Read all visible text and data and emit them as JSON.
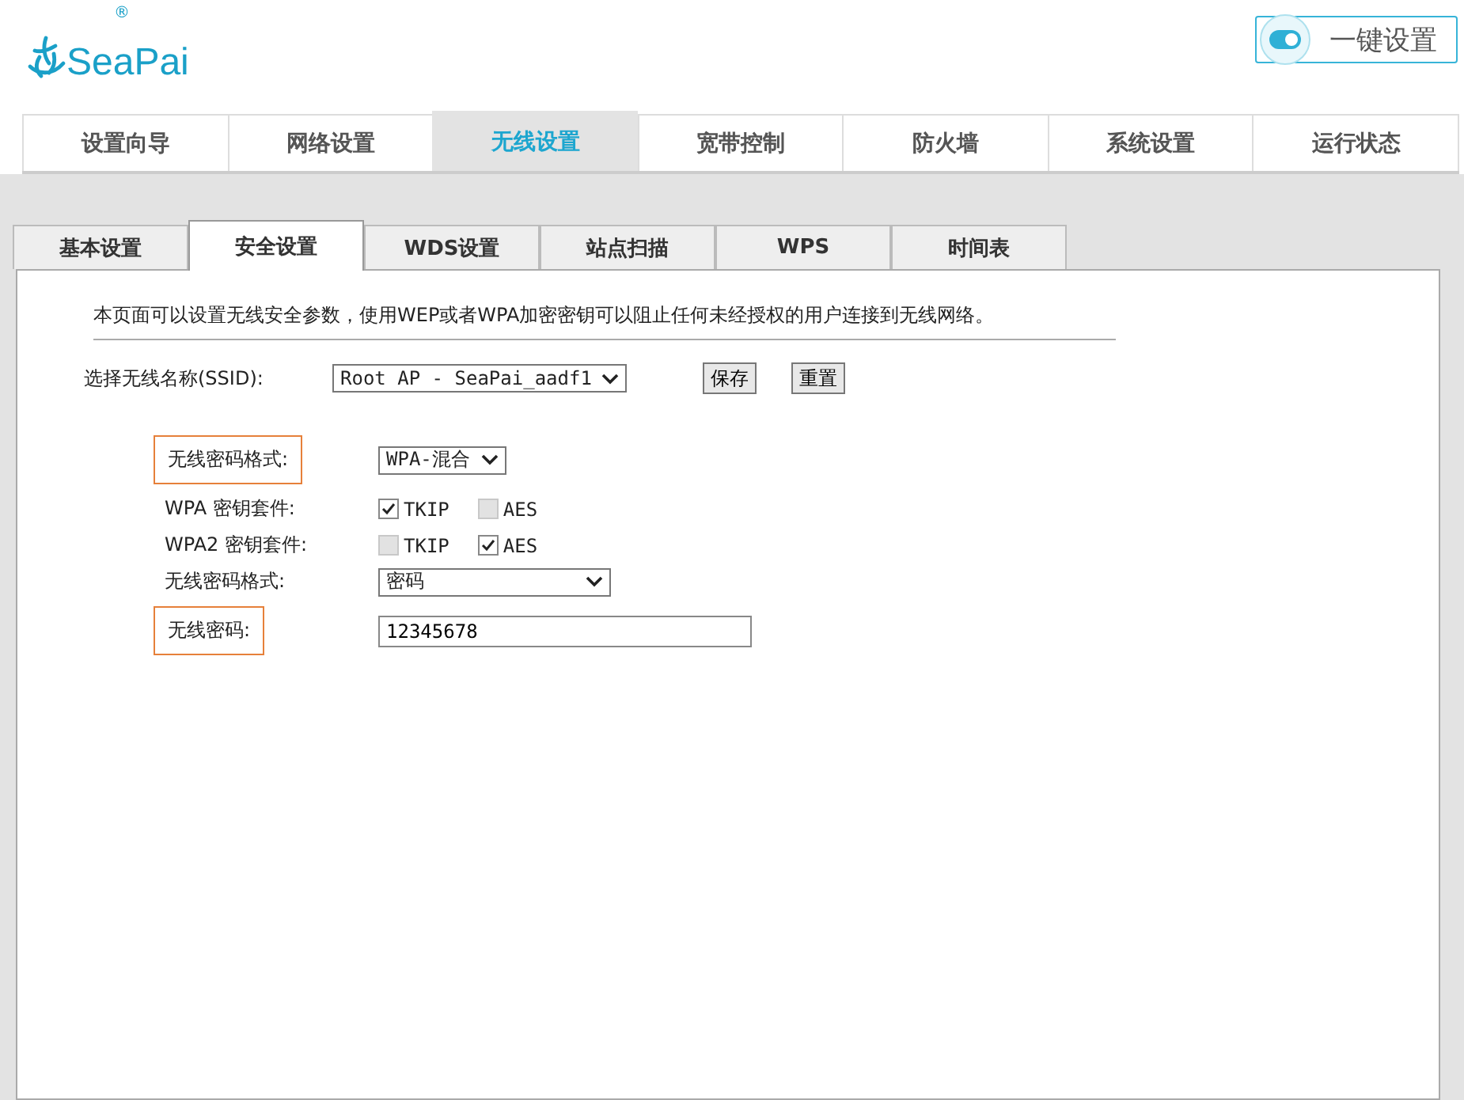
{
  "header": {
    "logo": "SeaPai",
    "logo_mark": "®",
    "quick_setup": {
      "label": "一键设置",
      "on": true
    }
  },
  "nav_tabs": [
    {
      "label": "设置向导",
      "selected": false
    },
    {
      "label": "网络设置",
      "selected": false
    },
    {
      "label": "无线设置",
      "selected": true
    },
    {
      "label": "宽带控制",
      "selected": false
    },
    {
      "label": "防火墙",
      "selected": false
    },
    {
      "label": "系统设置",
      "selected": false
    },
    {
      "label": "运行状态",
      "selected": false
    }
  ],
  "sub_tabs": [
    {
      "label": "基本设置",
      "selected": false
    },
    {
      "label": "安全设置",
      "selected": true
    },
    {
      "label": "WDS设置",
      "selected": false
    },
    {
      "label": "站点扫描",
      "selected": false
    },
    {
      "label": "WPS",
      "selected": false
    },
    {
      "label": "时间表",
      "selected": false
    }
  ],
  "description": "本页面可以设置无线安全参数，使用WEP或者WPA加密密钥可以阻止任何未经授权的用户连接到无线网络。",
  "ssid": {
    "label": "选择无线名称(SSID):",
    "value": "Root AP - SeaPai_aadf1",
    "buttons": [
      "保存",
      "重置"
    ]
  },
  "rows": [
    {
      "kind": "select",
      "label": "无线密码格式:",
      "highlighted": true,
      "value": "WPA-混合",
      "wide": false
    },
    {
      "kind": "checkboxes",
      "label": "WPA 密钥套件:",
      "highlighted": false,
      "options": [
        {
          "label": "TKIP",
          "checked": true
        },
        {
          "label": "AES",
          "checked": false
        }
      ]
    },
    {
      "kind": "checkboxes",
      "label": "WPA2 密钥套件:",
      "highlighted": false,
      "options": [
        {
          "label": "TKIP",
          "checked": false
        },
        {
          "label": "AES",
          "checked": true
        }
      ]
    },
    {
      "kind": "select",
      "label": "无线密码格式:",
      "highlighted": false,
      "value": "密码",
      "wide": true
    },
    {
      "kind": "input",
      "label": "无线密码:",
      "highlighted": true,
      "value": "12345678"
    }
  ]
}
